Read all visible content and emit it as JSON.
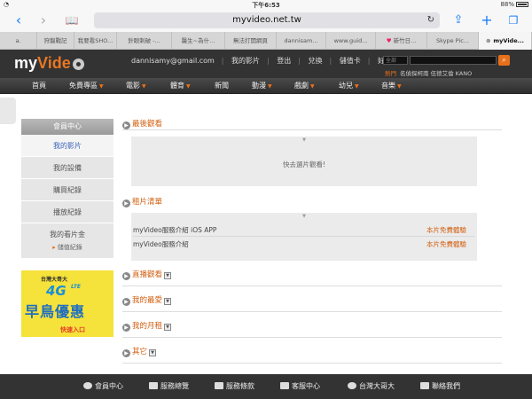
{
  "status": {
    "time": "下午6:53",
    "battery": "88%"
  },
  "browser": {
    "url": "myvideo.net.tw",
    "tabs": [
      {
        "label": "a."
      },
      {
        "label": "狩龍戰記"
      },
      {
        "label": "我要看SHO..."
      },
      {
        "label": "針眼剌破 -..."
      },
      {
        "label": "醫生~為什..."
      },
      {
        "label": "無法打開網頁"
      },
      {
        "label": "dannisam..."
      },
      {
        "label": "www.guid..."
      },
      {
        "label": "新竹日..."
      },
      {
        "label": "Skype Pic..."
      },
      {
        "label": "myVide..."
      }
    ]
  },
  "site": {
    "logo_a": "my",
    "logo_b": "Vide",
    "email": "dannisamy@gmail.com",
    "toplinks": [
      "我的影片",
      "登出",
      "兌換",
      "儲值卡",
      "好康優惠"
    ],
    "search_scope": "全部",
    "hot_label": "熱門",
    "hot_terms": "名偵探柯南 伍德艾倫 KANO",
    "nav": [
      "首頁",
      "免費專區",
      "電影",
      "體育",
      "新聞",
      "動漫",
      "戲劇",
      "幼兒",
      "音樂"
    ]
  },
  "sidebar": {
    "header": "會員中心",
    "items": [
      "我的影片",
      "我的設備",
      "購買紀錄",
      "播放紀錄"
    ],
    "wallet": "我的看片金",
    "wallet_sub": "儲值紀錄"
  },
  "ad": {
    "brand": "台灣大哥大",
    "network": "4G",
    "lte": "LTE",
    "promo": "早鳥優惠",
    "enter": "快速入口"
  },
  "main": {
    "last_watched": "最後觀看",
    "empty_msg": "快去選片觀看!",
    "rentals_title": "租片清單",
    "rentals": [
      {
        "name": "myVideo服務介紹 iOS APP",
        "action": "本片免費體驗"
      },
      {
        "name": "myVideo服務介紹",
        "action": "本片免費體驗"
      }
    ],
    "sections": [
      "直播觀看",
      "我的最愛",
      "我的月租",
      "其它"
    ]
  },
  "footer": [
    "會員中心",
    "服務總覽",
    "服務條款",
    "客服中心",
    "台灣大哥大",
    "聯絡我們"
  ]
}
